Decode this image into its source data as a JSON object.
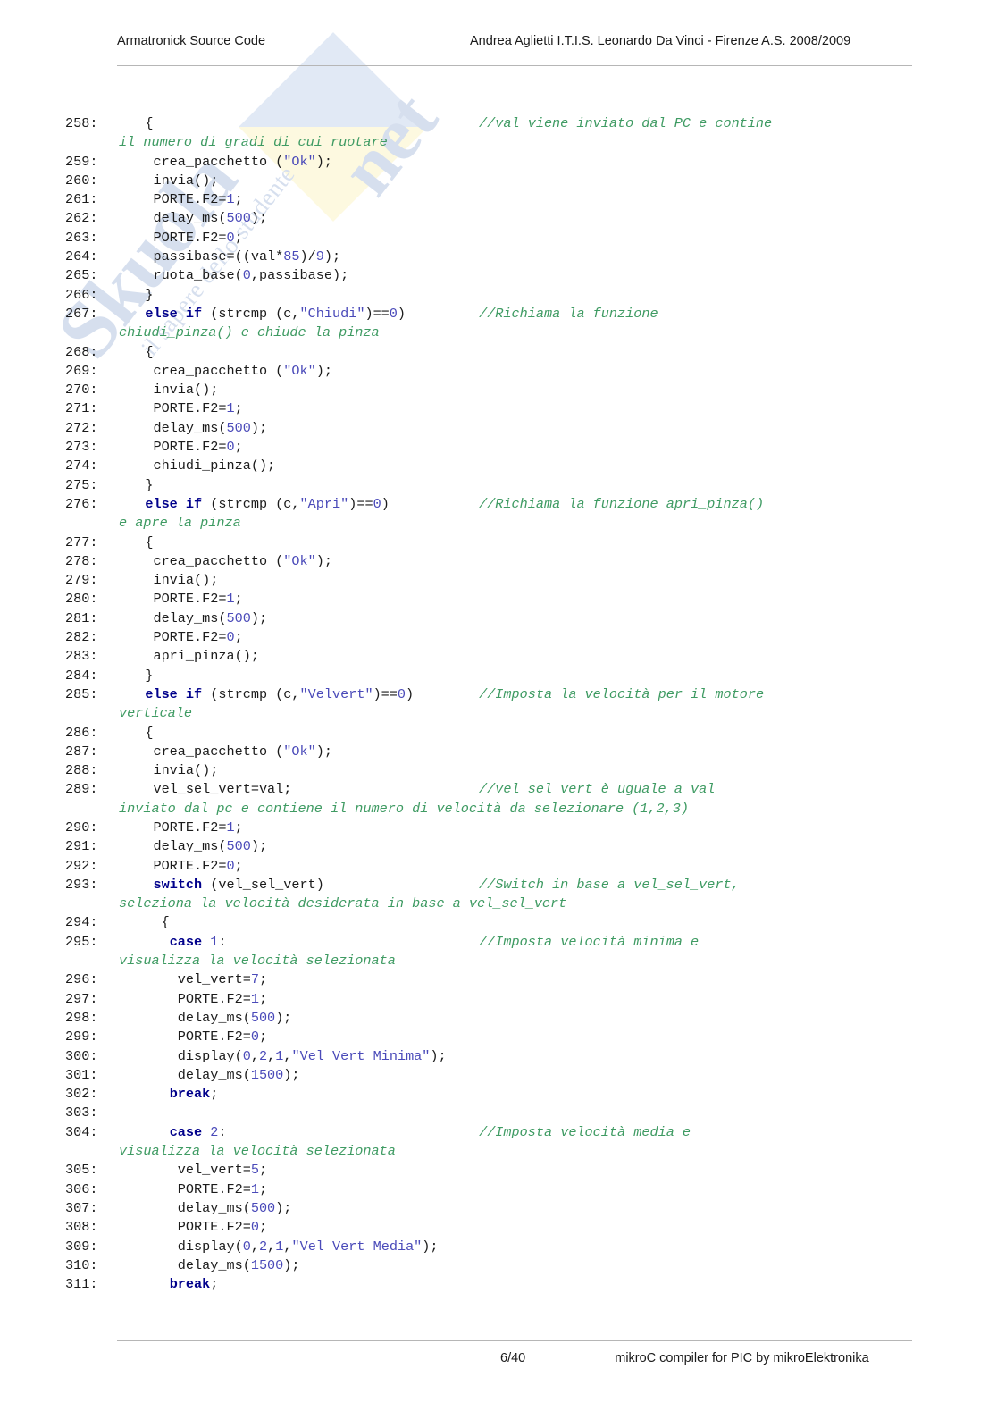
{
  "header": {
    "left": "Armatronick Source Code",
    "right": "Andrea Aglietti I.T.I.S. Leonardo Da Vinci - Firenze A.S. 2008/2009"
  },
  "footer": {
    "page": "6/40",
    "note": "mikroC compiler for PIC by mikroElektronika"
  },
  "watermark": {
    "brand": "Skuola",
    "suffix": "net",
    "tagline": "il sapere dello studente"
  },
  "colors": {
    "keyword": "#00008b",
    "string": "#4a4ab9",
    "number": "#4a4ab9",
    "comment": "#3f9b63",
    "text": "#1b1b1b",
    "rule": "#b6b6b6",
    "watermark_blue": "#b9cbe8",
    "watermark_yellow": "#fbf2b6"
  },
  "code": {
    "lines": [
      {
        "n": "258:",
        "indent": "   ",
        "code": "{",
        "comment": "//val viene inviato dal PC e contine",
        "continuation": "il numero di gradi di cui ruotare"
      },
      {
        "n": "259:",
        "indent": "    ",
        "code": "crea_pacchetto (\"Ok\");"
      },
      {
        "n": "260:",
        "indent": "    ",
        "code": "invia();"
      },
      {
        "n": "261:",
        "indent": "    ",
        "code": "PORTE.F2=1;"
      },
      {
        "n": "262:",
        "indent": "    ",
        "code": "delay_ms(500);"
      },
      {
        "n": "263:",
        "indent": "    ",
        "code": "PORTE.F2=0;"
      },
      {
        "n": "264:",
        "indent": "    ",
        "code": "passibase=((val*85)/9);"
      },
      {
        "n": "265:",
        "indent": "    ",
        "code": "ruota_base(0,passibase);"
      },
      {
        "n": "266:",
        "indent": "   ",
        "code": "}"
      },
      {
        "n": "267:",
        "indent": "   ",
        "code": "else if (strcmp (c,\"Chiudi\")==0)",
        "comment": "//Richiama la funzione",
        "continuation": "chiudi_pinza() e chiude la pinza"
      },
      {
        "n": "268:",
        "indent": "   ",
        "code": "{"
      },
      {
        "n": "269:",
        "indent": "    ",
        "code": "crea_pacchetto (\"Ok\");"
      },
      {
        "n": "270:",
        "indent": "    ",
        "code": "invia();"
      },
      {
        "n": "271:",
        "indent": "    ",
        "code": "PORTE.F2=1;"
      },
      {
        "n": "272:",
        "indent": "    ",
        "code": "delay_ms(500);"
      },
      {
        "n": "273:",
        "indent": "    ",
        "code": "PORTE.F2=0;"
      },
      {
        "n": "274:",
        "indent": "    ",
        "code": "chiudi_pinza();"
      },
      {
        "n": "275:",
        "indent": "   ",
        "code": "}"
      },
      {
        "n": "276:",
        "indent": "   ",
        "code": "else if (strcmp (c,\"Apri\")==0)",
        "comment": "//Richiama la funzione apri_pinza()",
        "continuation": "e apre la pinza"
      },
      {
        "n": "277:",
        "indent": "   ",
        "code": "{"
      },
      {
        "n": "278:",
        "indent": "    ",
        "code": "crea_pacchetto (\"Ok\");"
      },
      {
        "n": "279:",
        "indent": "    ",
        "code": "invia();"
      },
      {
        "n": "280:",
        "indent": "    ",
        "code": "PORTE.F2=1;"
      },
      {
        "n": "281:",
        "indent": "    ",
        "code": "delay_ms(500);"
      },
      {
        "n": "282:",
        "indent": "    ",
        "code": "PORTE.F2=0;"
      },
      {
        "n": "283:",
        "indent": "    ",
        "code": "apri_pinza();"
      },
      {
        "n": "284:",
        "indent": "   ",
        "code": "}"
      },
      {
        "n": "285:",
        "indent": "   ",
        "code": "else if (strcmp (c,\"Velvert\")==0)",
        "comment": "//Imposta la velocità per il motore",
        "continuation": "verticale"
      },
      {
        "n": "286:",
        "indent": "   ",
        "code": "{"
      },
      {
        "n": "287:",
        "indent": "    ",
        "code": "crea_pacchetto (\"Ok\");"
      },
      {
        "n": "288:",
        "indent": "    ",
        "code": "invia();"
      },
      {
        "n": "289:",
        "indent": "    ",
        "code": "vel_sel_vert=val;",
        "comment": "//vel_sel_vert è uguale a val",
        "continuation": "inviato dal pc e contiene il numero di velocità da selezionare (1,2,3)"
      },
      {
        "n": "290:",
        "indent": "    ",
        "code": "PORTE.F2=1;"
      },
      {
        "n": "291:",
        "indent": "    ",
        "code": "delay_ms(500);"
      },
      {
        "n": "292:",
        "indent": "    ",
        "code": "PORTE.F2=0;"
      },
      {
        "n": "293:",
        "indent": "    ",
        "code": "switch (vel_sel_vert)",
        "comment": "//Switch in base a vel_sel_vert,",
        "continuation": "seleziona la velocità desiderata in base a vel_sel_vert"
      },
      {
        "n": "294:",
        "indent": "     ",
        "code": "{"
      },
      {
        "n": "295:",
        "indent": "      ",
        "code": "case 1:",
        "comment": "//Imposta velocità minima e",
        "continuation": "visualizza la velocità selezionata"
      },
      {
        "n": "296:",
        "indent": "       ",
        "code": "vel_vert=7;"
      },
      {
        "n": "297:",
        "indent": "       ",
        "code": "PORTE.F2=1;"
      },
      {
        "n": "298:",
        "indent": "       ",
        "code": "delay_ms(500);"
      },
      {
        "n": "299:",
        "indent": "       ",
        "code": "PORTE.F2=0;"
      },
      {
        "n": "300:",
        "indent": "       ",
        "code": "display(0,2,1,\"Vel Vert Minima\");"
      },
      {
        "n": "301:",
        "indent": "       ",
        "code": "delay_ms(1500);"
      },
      {
        "n": "302:",
        "indent": "      ",
        "code": "break;"
      },
      {
        "n": "303:",
        "indent": "",
        "code": ""
      },
      {
        "n": "304:",
        "indent": "      ",
        "code": "case 2:",
        "comment": "//Imposta velocità media e",
        "continuation": "visualizza la velocità selezionata"
      },
      {
        "n": "305:",
        "indent": "       ",
        "code": "vel_vert=5;"
      },
      {
        "n": "306:",
        "indent": "       ",
        "code": "PORTE.F2=1;"
      },
      {
        "n": "307:",
        "indent": "       ",
        "code": "delay_ms(500);"
      },
      {
        "n": "308:",
        "indent": "       ",
        "code": "PORTE.F2=0;"
      },
      {
        "n": "309:",
        "indent": "       ",
        "code": "display(0,2,1,\"Vel Vert Media\");"
      },
      {
        "n": "310:",
        "indent": "       ",
        "code": "delay_ms(1500);"
      },
      {
        "n": "311:",
        "indent": "      ",
        "code": "break;"
      }
    ]
  }
}
